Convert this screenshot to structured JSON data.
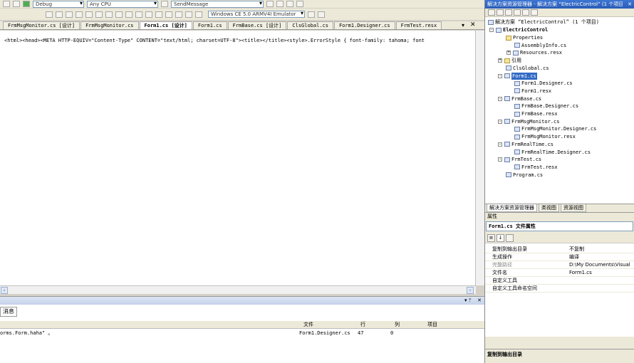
{
  "toolbar": {
    "config": "Debug",
    "platform": "Any CPU",
    "method": "SendMessage",
    "device": "Windows CE 5.0 ARMV4I Emulator"
  },
  "tabs": [
    {
      "label": "FrmMsgMonitor.cs [设计]"
    },
    {
      "label": "FrmMsgMonitor.cs"
    },
    {
      "label": "Form1.cs [设计]",
      "active": true
    },
    {
      "label": "Form1.cs"
    },
    {
      "label": "FrmBase.cs [设计]"
    },
    {
      "label": "ClsGlobal.cs"
    },
    {
      "label": "Form1.Designer.cs"
    },
    {
      "label": "FrmTest.resx"
    }
  ],
  "editor": {
    "code_line": "<html><head><META HTTP-EQUIV=\"Content-Type\" CONTENT=\"text/html; charset=UTF-8\"><title></title><style>.ErrorStyle { font-family: tahoma; font"
  },
  "output": {
    "tab_label": "消息",
    "columns": {
      "file": "文件",
      "line": "行",
      "col": "列",
      "project": "项目"
    },
    "rows": [
      {
        "desc": "orms.Form.haha\" 。",
        "file": "Form1.Designer.cs",
        "line": "47",
        "col": "0",
        "project": ""
      }
    ]
  },
  "solution_explorer": {
    "title": "解决方案资源管理器 - 解决方案 “ElectricControl” (1 个项目)",
    "solution_label": "解决方案 “ElectricControl” (1 个项目)",
    "project": "ElectricControl",
    "items": [
      {
        "label": "Properties",
        "indent": 2,
        "icon": "folder"
      },
      {
        "label": "AssemblyInfo.cs",
        "indent": 3,
        "icon": "file"
      },
      {
        "label": "Resources.resx",
        "indent": 3,
        "icon": "file",
        "expander": "+"
      },
      {
        "label": "引用",
        "indent": 2,
        "icon": "folder",
        "expander": "+"
      },
      {
        "label": "ClsGlobal.cs",
        "indent": 2,
        "icon": "file"
      },
      {
        "label": "Form1.cs",
        "indent": 2,
        "icon": "form",
        "expander": "-",
        "selected": true
      },
      {
        "label": "Form1.Designer.cs",
        "indent": 3,
        "icon": "file"
      },
      {
        "label": "Form1.resx",
        "indent": 3,
        "icon": "file"
      },
      {
        "label": "FrmBase.cs",
        "indent": 2,
        "icon": "form",
        "expander": "-"
      },
      {
        "label": "FrmBase.Designer.cs",
        "indent": 3,
        "icon": "file"
      },
      {
        "label": "FrmBase.resx",
        "indent": 3,
        "icon": "file"
      },
      {
        "label": "FrmMsgMonitor.cs",
        "indent": 2,
        "icon": "form",
        "expander": "-"
      },
      {
        "label": "FrmMsgMonitor.Designer.cs",
        "indent": 3,
        "icon": "file"
      },
      {
        "label": "FrmMsgMonitor.resx",
        "indent": 3,
        "icon": "file"
      },
      {
        "label": "FrmRealTime.cs",
        "indent": 2,
        "icon": "form",
        "expander": "-"
      },
      {
        "label": "FrmRealTime.Designer.cs",
        "indent": 3,
        "icon": "file"
      },
      {
        "label": "FrmTest.cs",
        "indent": 2,
        "icon": "form",
        "expander": "-"
      },
      {
        "label": "FrmTest.resx",
        "indent": 3,
        "icon": "file"
      },
      {
        "label": "Program.cs",
        "indent": 2,
        "icon": "file"
      }
    ],
    "bottom_tabs": [
      "解决方案资源管理器",
      "类视图",
      "资源视图"
    ]
  },
  "properties": {
    "header": "属性",
    "object": "Form1.cs 文件属性",
    "rows": [
      {
        "key": "复制到输出目录",
        "value": "不复制"
      },
      {
        "key": "生成操作",
        "value": "编译"
      },
      {
        "key": "完整路径",
        "value": "D:\\My Documents\\Visual",
        "dim": true
      },
      {
        "key": "文件名",
        "value": "Form1.cs"
      },
      {
        "key": "自定义工具",
        "value": ""
      },
      {
        "key": "自定义工具命名空间",
        "value": ""
      }
    ],
    "desc_title": "复制到输出目录"
  }
}
